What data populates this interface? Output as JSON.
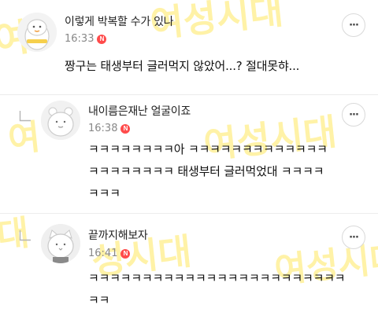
{
  "watermark_text": "여성시대",
  "watermark_fragments": [
    "여",
    "대",
    "여성시대",
    "성시대"
  ],
  "more_label": "···",
  "new_badge": "N",
  "comments": [
    {
      "author": "이렇게 박복할 수가 있나",
      "time": "16:33",
      "body": "짱구는 태생부터 글러먹지 않았어...? 절대못햐...",
      "is_reply": false,
      "avatar": "penguin-avatar"
    },
    {
      "author": "내이름은재난 얼굴이죠",
      "time": "16:38",
      "body_lines": [
        "ㅋㅋㅋㅋㅋㅋㅋㅋ아 ㅋㅋㅋㅋㅋㅋㅋㅋㅋㅋㅋㅋㅋ",
        "ㅋㅋㅋㅋㅋㅋㅋㅋ 태생부터 글러먹었대 ㅋㅋㅋㅋ",
        "ㅋㅋㅋ"
      ],
      "is_reply": true,
      "avatar": "bear-avatar"
    },
    {
      "author": "끝까지해보자",
      "time": "16:41",
      "body_lines": [
        "ㅋㅋㅋㅋㅋㅋㅋㅋㅋㅋㅋㅋㅋㅋㅋㅋㅋㅋㅋㅋㅋㅋㅋㅋ",
        "ㅋㅋ"
      ],
      "is_reply": true,
      "avatar": "cat-avatar"
    }
  ],
  "colors": {
    "badge": "#ff4b4b",
    "watermark": "#ffe23c",
    "divider": "#ececec",
    "meta": "#888888"
  }
}
